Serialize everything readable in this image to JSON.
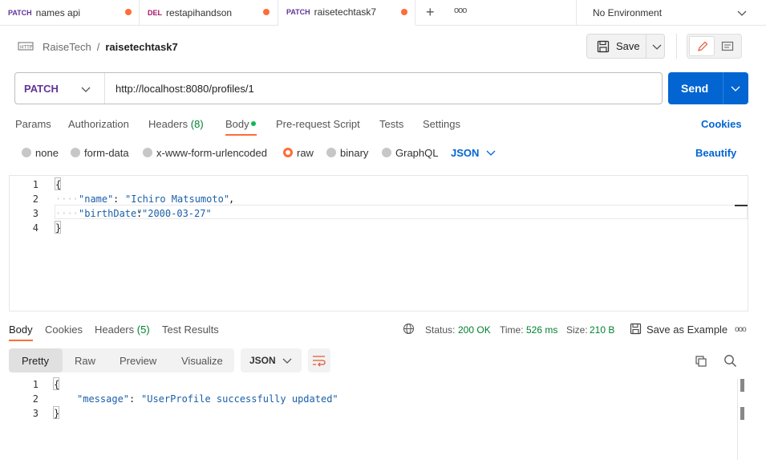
{
  "tabs": [
    {
      "method": "PATCH",
      "title": "names api",
      "method_color": "#623497"
    },
    {
      "method": "DEL",
      "title": "restapihandson",
      "method_color": "#a61468"
    },
    {
      "method": "PATCH",
      "title": "raisetechtask7",
      "method_color": "#623497"
    }
  ],
  "environment": "No Environment",
  "breadcrumb": {
    "collection": "RaiseTech",
    "separator": "/",
    "request": "raisetechtask7"
  },
  "save_label": "Save",
  "request": {
    "method": "PATCH",
    "url": "http://localhost:8080/profiles/1",
    "send_label": "Send"
  },
  "request_tabs": {
    "params": "Params",
    "authorization": "Authorization",
    "headers": "Headers",
    "headers_count": "(8)",
    "body": "Body",
    "pre_request": "Pre-request Script",
    "tests": "Tests",
    "settings": "Settings",
    "cookies": "Cookies"
  },
  "body_options": {
    "none": "none",
    "form_data": "form-data",
    "urlencoded": "x-www-form-urlencoded",
    "raw": "raw",
    "binary": "binary",
    "graphql": "GraphQL",
    "format": "JSON",
    "beautify": "Beautify"
  },
  "request_body": {
    "lines": [
      "1",
      "2",
      "3",
      "4"
    ],
    "open_brace": "{",
    "key1": "\"name\"",
    "val1": "\"Ichiro Matsumoto\"",
    "key2": "\"birthDate\"",
    "val2": "\"2000-03-27\"",
    "close_brace": "}"
  },
  "response_tabs": {
    "body": "Body",
    "cookies": "Cookies",
    "headers": "Headers",
    "headers_count": "(5)",
    "test_results": "Test Results"
  },
  "status": {
    "status_label": "Status:",
    "status_value": "200 OK",
    "time_label": "Time:",
    "time_value": "526 ms",
    "size_label": "Size:",
    "size_value": "210 B",
    "save_example": "Save as Example"
  },
  "view_modes": {
    "pretty": "Pretty",
    "raw": "Raw",
    "preview": "Preview",
    "visualize": "Visualize",
    "format": "JSON"
  },
  "response_body": {
    "lines": [
      "1",
      "2",
      "3"
    ],
    "open_brace": "{",
    "key": "\"message\"",
    "val": "\"UserProfile successfully updated\"",
    "close_brace": "}"
  },
  "colors": {
    "accent": "#ff6c37",
    "send": "#0265d2",
    "status_ok": "#007f31",
    "link": "#0265d2",
    "body_dot": "#0cbb52"
  }
}
